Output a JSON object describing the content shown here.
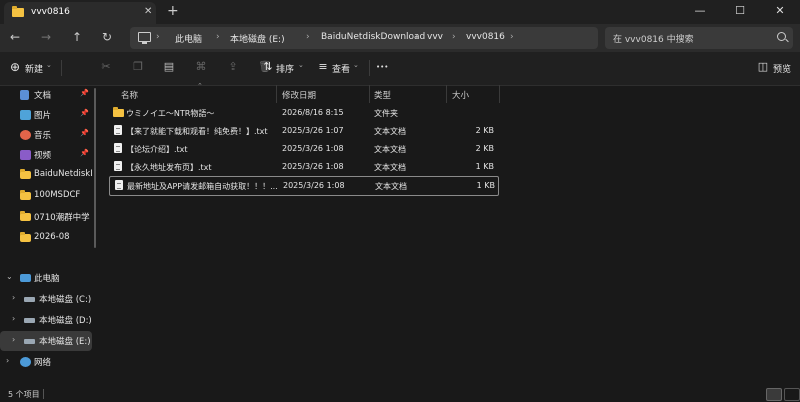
{
  "window": {
    "tab_title": "vvv0816",
    "tab_close": "✕",
    "new_tab": "+",
    "minimize": "—",
    "maximize": "☐",
    "close": "✕"
  },
  "nav": {
    "back": "←",
    "forward": "→",
    "up": "↑",
    "refresh": "↻",
    "breadcrumbs": [
      "此电脑",
      "本地磁盘 (E:)",
      "BaiduNetdiskDownload",
      "vvv",
      "vvv0816"
    ],
    "separator": "›",
    "search_placeholder": "在 vvv0816 中搜索"
  },
  "toolbar": {
    "new_label": "新建",
    "sort_label": "排序",
    "view_label": "查看",
    "more_label": "•••",
    "preview_label": "预览"
  },
  "sidebar": {
    "quick": [
      {
        "label": "文档",
        "pinned": true
      },
      {
        "label": "图片",
        "pinned": true
      },
      {
        "label": "音乐",
        "pinned": true
      },
      {
        "label": "视频",
        "pinned": true
      },
      {
        "label": "BaiduNetdiskD"
      },
      {
        "label": "100MSDCF"
      },
      {
        "label": "0710潮群中学"
      },
      {
        "label": "2026-08"
      }
    ],
    "this_pc": "此电脑",
    "drives": [
      "本地磁盘 (C:)",
      "本地磁盘 (D:)",
      "本地磁盘 (E:)"
    ],
    "network": "网络"
  },
  "list": {
    "headers": {
      "name": "名称",
      "modified": "修改日期",
      "type": "类型",
      "size": "大小"
    },
    "rows": [
      {
        "name": "ウミノイエ～NTR物語～",
        "modified": "2026/8/16 8:15",
        "type": "文件夹",
        "size": "",
        "kind": "folder"
      },
      {
        "name": "【来了就能下载和观看！纯免费！】.txt",
        "modified": "2025/3/26 1:07",
        "type": "文本文档",
        "size": "2 KB",
        "kind": "txt"
      },
      {
        "name": "【论坛介绍】.txt",
        "modified": "2025/3/26 1:08",
        "type": "文本文档",
        "size": "2 KB",
        "kind": "txt"
      },
      {
        "name": "【永久地址发布页】.txt",
        "modified": "2025/3/26 1:08",
        "type": "文本文档",
        "size": "1 KB",
        "kind": "txt"
      },
      {
        "name": "最新地址及APP请发邮箱自动获取！！！...",
        "modified": "2025/3/26 1:08",
        "type": "文本文档",
        "size": "1 KB",
        "kind": "txt"
      }
    ]
  },
  "status": {
    "count": "5 个项目"
  },
  "colors": {
    "folder": "#f5c242",
    "background": "#191919",
    "chrome": "#2b2b2b"
  }
}
